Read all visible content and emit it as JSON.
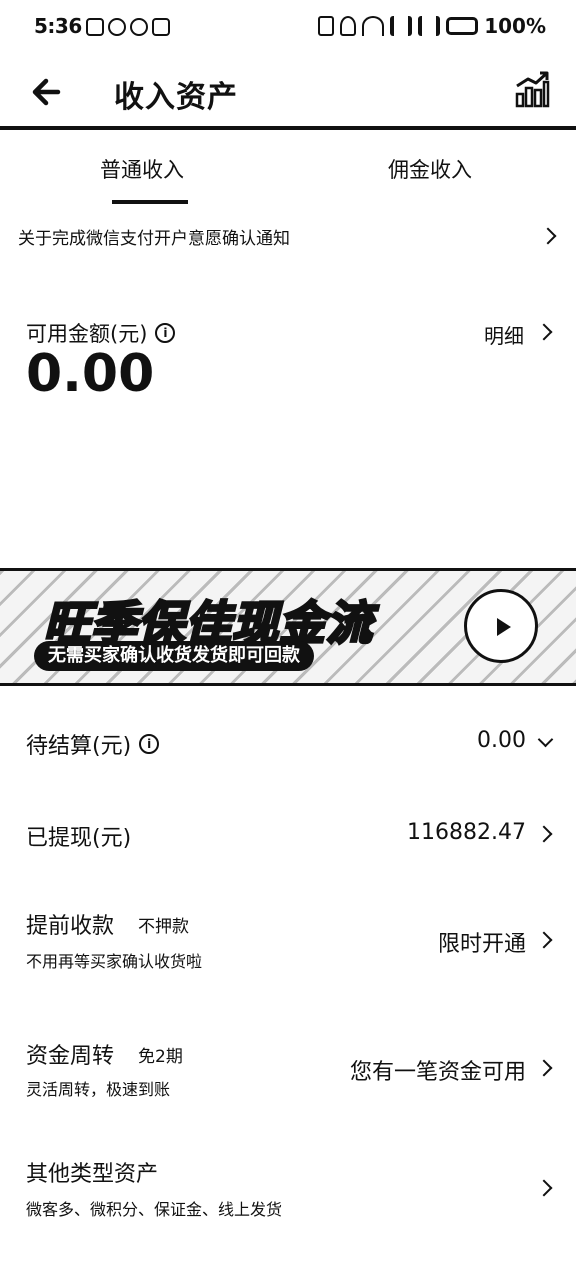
{
  "status_bar": {
    "time": "5:36",
    "battery": "100%"
  },
  "header": {
    "title": "收入资产"
  },
  "tabs": [
    {
      "label": "普通收入",
      "active": true
    },
    {
      "label": "佣金收入",
      "active": false
    }
  ],
  "notice": {
    "text": "关于完成微信支付开户意愿确认通知"
  },
  "balance": {
    "label": "可用金额(元)",
    "value": "0.00",
    "detail_label": "明细"
  },
  "banner": {
    "title": "旺季保佳现金流",
    "subtitle": "无需买家确认收货发货即可回款"
  },
  "rows": {
    "pending": {
      "title": "待结算(元)",
      "value": "0.00"
    },
    "withdrawn": {
      "title": "已提现(元)",
      "value": "116882.47"
    },
    "early": {
      "title": "提前收款",
      "tag": "不押款",
      "sub": "不用再等买家确认收货啦",
      "value": "限时开通"
    },
    "turnover": {
      "title": "资金周转",
      "tag": "免2期",
      "sub": "灵活周转，极速到账",
      "value": "您有一笔资金可用"
    },
    "other": {
      "title": "其他类型资产",
      "sub": "微客多、微积分、保证金、线上发货"
    }
  }
}
